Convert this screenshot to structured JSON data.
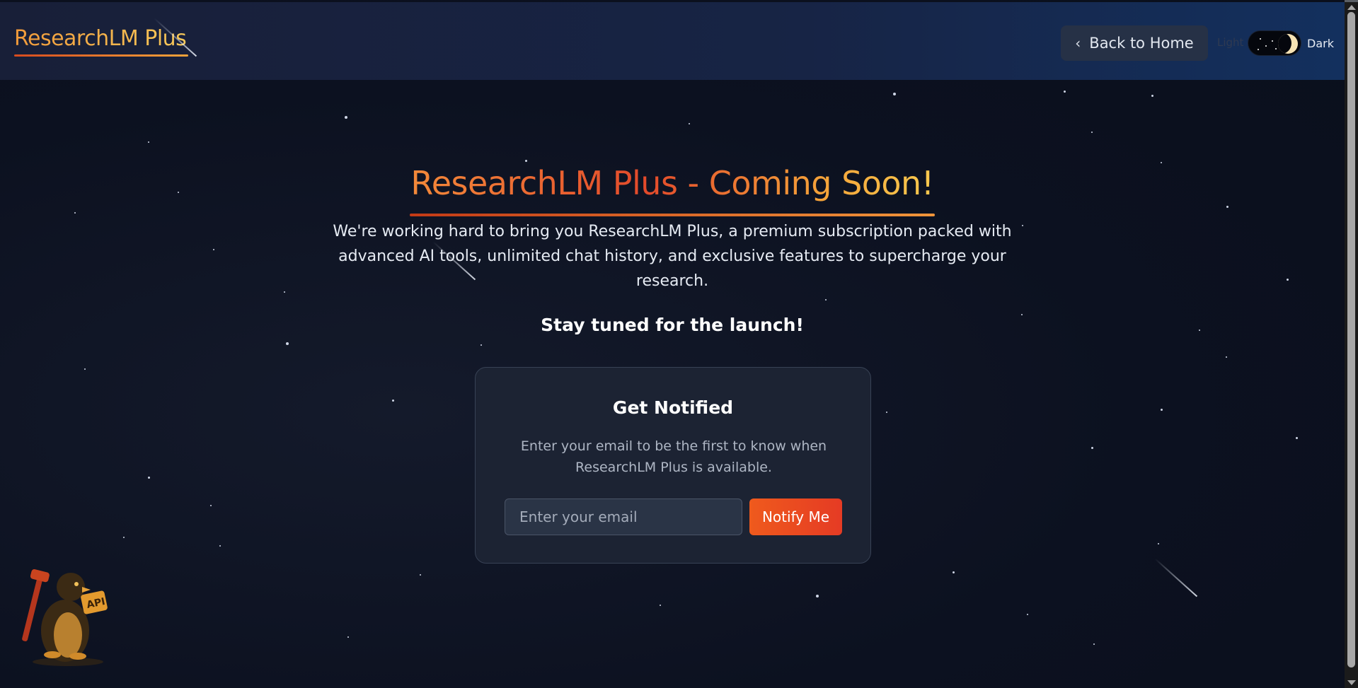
{
  "header": {
    "logo": "ResearchLM Plus",
    "back_label": "Back to Home",
    "theme_light_label": "Light",
    "theme_dark_label": "Dark",
    "theme_mode": "dark"
  },
  "main": {
    "title": "ResearchLM Plus - Coming Soon!",
    "description": "We're working hard to bring you ResearchLM Plus, a premium subscription packed with advanced AI tools, unlimited chat history, and exclusive features to supercharge your research.",
    "tagline": "Stay tuned for the launch!"
  },
  "notify_card": {
    "title": "Get Notified",
    "description": "Enter your email to be the first to know when ResearchLM Plus is available.",
    "email_placeholder": "Enter your email",
    "email_value": "",
    "button_label": "Notify Me"
  },
  "mascot": {
    "badge_text": "API"
  },
  "colors": {
    "accent_orange": "#f0953a",
    "accent_red": "#e53b24",
    "background": "#0d1220",
    "card": "#1c2333"
  },
  "icons": {
    "back": "chevron-left-icon",
    "theme": "moon-icon"
  }
}
